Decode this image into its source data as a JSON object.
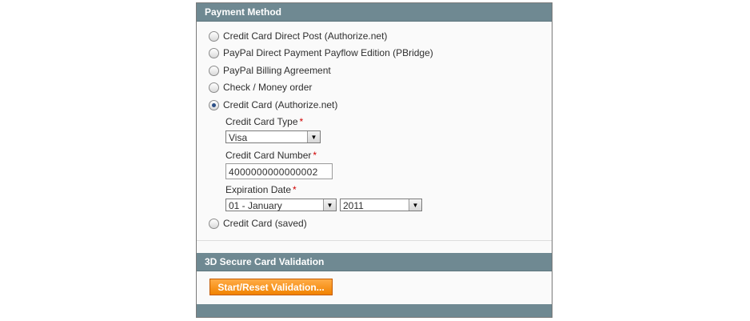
{
  "payment": {
    "title": "Payment Method",
    "options": [
      {
        "label": "Credit Card Direct Post (Authorize.net)",
        "selected": false
      },
      {
        "label": "PayPal Direct Payment Payflow Edition (PBridge)",
        "selected": false
      },
      {
        "label": "PayPal Billing Agreement",
        "selected": false
      },
      {
        "label": "Check / Money order",
        "selected": false
      },
      {
        "label": "Credit Card (Authorize.net)",
        "selected": true
      },
      {
        "label": "Credit Card (saved)",
        "selected": false
      }
    ],
    "card_type": {
      "label": "Credit Card Type",
      "required_mark": "*",
      "value": "Visa"
    },
    "card_number": {
      "label": "Credit Card Number",
      "required_mark": "*",
      "value": "4000000000000002"
    },
    "expiration": {
      "label": "Expiration Date",
      "required_mark": "*",
      "month": "01 - January",
      "year": "2011"
    }
  },
  "secure": {
    "title": "3D Secure Card Validation",
    "button_label": "Start/Reset Validation..."
  },
  "colors": {
    "header": "#6f8992",
    "button": "#f18200",
    "required": "#d00000",
    "radio_dot": "#2c4f86"
  }
}
